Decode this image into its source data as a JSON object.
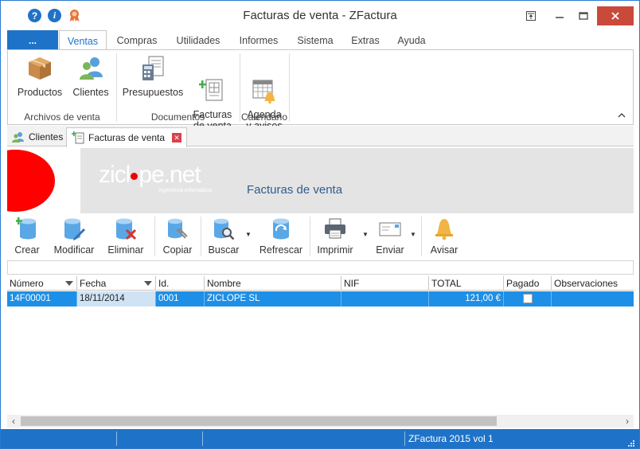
{
  "window": {
    "title": "Facturas de venta - ZFactura"
  },
  "titlebar_icons": [
    "help-icon",
    "info-icon",
    "ribbon-award-icon"
  ],
  "ribbon": {
    "file_tab": "...",
    "tabs": [
      "Ventas",
      "Compras",
      "Utilidades",
      "Informes",
      "Sistema",
      "Extras",
      "Ayuda"
    ],
    "active_tab": "Ventas",
    "groups": [
      {
        "label": "Archivos de venta",
        "buttons": [
          "Productos",
          "Clientes"
        ]
      },
      {
        "label": "Documentos",
        "buttons": [
          "Presupuestos",
          "Facturas\nde venta"
        ]
      },
      {
        "label": "Calendario",
        "buttons": [
          "Agenda\ny avisos"
        ]
      }
    ],
    "collapse_glyph": "^"
  },
  "doc_tabs": [
    {
      "label": "Clientes",
      "active": false
    },
    {
      "label": "Facturas de venta",
      "active": true
    }
  ],
  "banner": {
    "logo_text_a": "zicl",
    "logo_text_b": "pe.net",
    "logo_subtitle": "ingeniería informática",
    "title": "Facturas de venta"
  },
  "toolbar": {
    "buttons": [
      "Crear",
      "Modificar",
      "Eliminar",
      "Copiar",
      "Buscar",
      "Refrescar",
      "Imprimir",
      "Enviar",
      "Avisar"
    ]
  },
  "grid": {
    "columns": [
      "Número",
      "Fecha",
      "Id.",
      "Nombre",
      "NIF",
      "TOTAL",
      "Pagado",
      "Observaciones"
    ],
    "rows": [
      {
        "numero": "14F00001",
        "fecha": "18/11/2014",
        "id": "0001",
        "nombre": "ZICLOPE SL",
        "nif": "",
        "total": "121,00 €",
        "pagado": false,
        "observaciones": ""
      }
    ]
  },
  "statusbar": {
    "version": "ZFactura 2015 vol 1"
  },
  "colors": {
    "accent": "#1e73c8",
    "selected_row": "#1e8fe6",
    "banner_red": "#ff0000",
    "banner_gray": "#e4e4e4"
  }
}
